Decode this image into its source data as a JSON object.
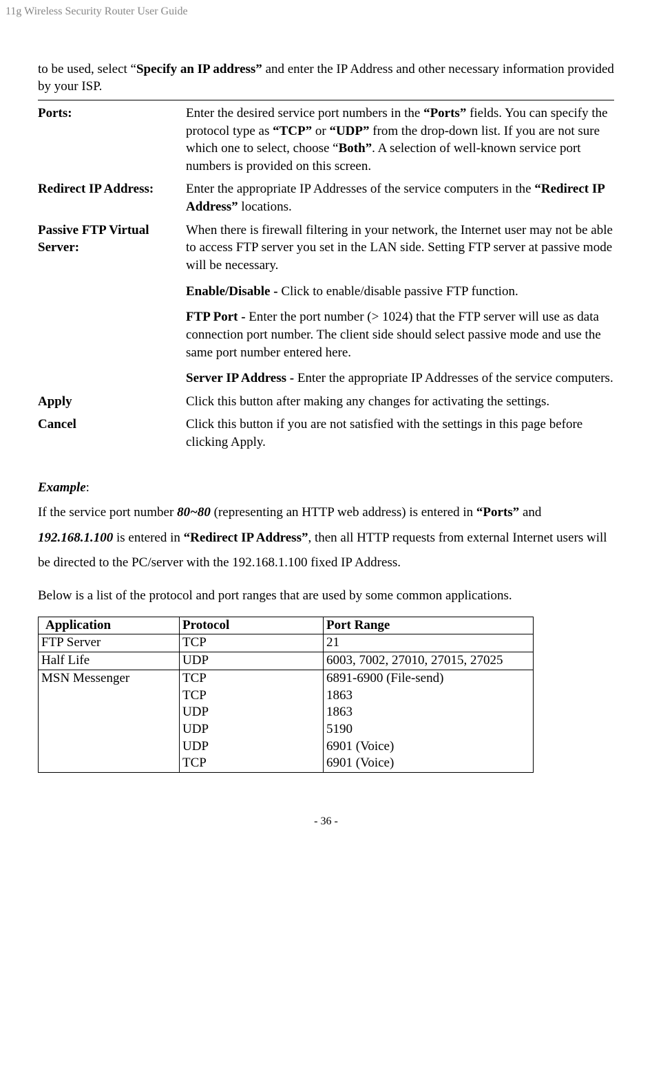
{
  "header": "11g Wireless Security Router User Guide",
  "intro": {
    "pre": "to be used, select “",
    "bold": "Specify an IP address”",
    "post": " and enter the IP Address and other necessary information provided by your ISP."
  },
  "rows": {
    "ports": {
      "label": "Ports:",
      "text_pre": "Enter the desired service port numbers in the ",
      "b1": "“Ports”",
      "text_mid1": " fields. You can specify the protocol type as ",
      "b2": "“TCP”",
      "text_or": " or ",
      "b3": "“UDP”",
      "text_mid2": " from the drop-down list. If you are not sure which one to select, choose “",
      "b4": "Both”",
      "text_post": ". A selection of well-known service port numbers is provided on this screen."
    },
    "redirect": {
      "label": "Redirect IP Address:",
      "pre": "Enter the appropriate IP Addresses of the service computers in the ",
      "b": "“Redirect IP Address”",
      "post": " locations."
    },
    "passive": {
      "label": "Passive FTP Virtual Server:",
      "p1": "When there is firewall filtering in your network, the Internet user may not be able to access FTP server you set in the LAN side. Setting FTP server at passive mode will be necessary.",
      "p2b": "Enable/Disable - ",
      "p2": "Click to enable/disable passive FTP function.",
      "p3b": "FTP Port - ",
      "p3": "Enter the port number (> 1024) that the FTP server will use as data connection port number. The client side should select passive mode and use the same port number entered here.",
      "p4b": "Server IP Address - ",
      "p4": "Enter the appropriate IP Addresses of the service computers."
    },
    "apply": {
      "label": "Apply",
      "text": "Click this button after making any changes for activating the settings."
    },
    "cancel": {
      "label": "Cancel",
      "text": "Click this button if you are not satisfied with the settings in this page before clicking Apply."
    }
  },
  "example": {
    "heading": "Example",
    "p1_pre": "If the service port number ",
    "p1_bi1": "80~80",
    "p1_mid1": " (representing an HTTP web address) is entered in ",
    "p1_b1": "“Ports”",
    "p1_mid2": " and ",
    "p1_bi2": "192.168.1.100",
    "p1_mid3": " is entered in ",
    "p1_b2": "“Redirect IP Address”",
    "p1_post": ", then all HTTP requests from external Internet users will be directed to the PC/server with the 192.168.1.100 fixed IP Address.",
    "p2": "Below is a list of the protocol and port ranges that are used by some common applications."
  },
  "table": {
    "headers": {
      "app": "Application",
      "proto": "Protocol",
      "range": "Port Range"
    },
    "r1": {
      "app": "FTP Server",
      "proto": "TCP",
      "range": "21"
    },
    "r2": {
      "app": "Half Life",
      "proto": "UDP",
      "range": "6003, 7002, 27010, 27015, 27025"
    },
    "r3": {
      "app": "MSN Messenger",
      "proto1": "TCP",
      "range1": "6891-6900 (File-send)",
      "proto2": "TCP",
      "range2": "1863",
      "proto3": "UDP",
      "range3": "1863",
      "proto4": "UDP",
      "range4": "5190",
      "proto5": "UDP",
      "range5": "6901 (Voice)",
      "proto6": "TCP",
      "range6": "6901 (Voice)"
    }
  },
  "footer": "- 36 -"
}
